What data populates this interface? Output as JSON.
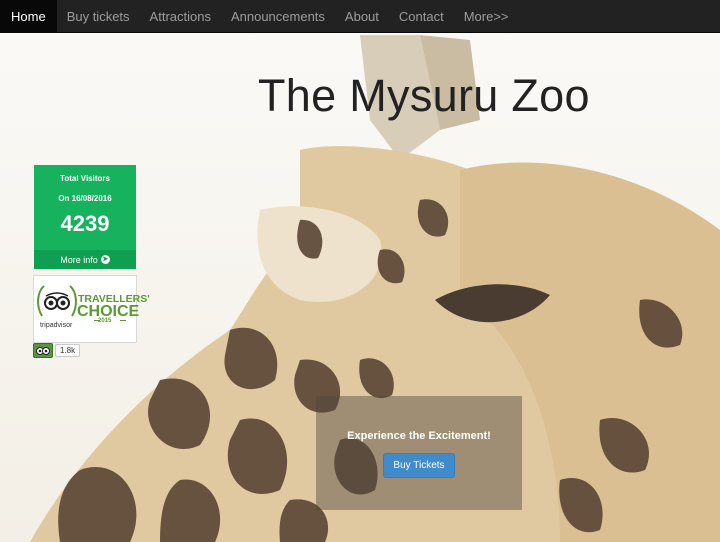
{
  "nav": {
    "items": [
      {
        "label": "Home",
        "active": true
      },
      {
        "label": "Buy tickets"
      },
      {
        "label": "Attractions"
      },
      {
        "label": "Announcements"
      },
      {
        "label": "About"
      },
      {
        "label": "Contact"
      },
      {
        "label": "More>>"
      }
    ]
  },
  "page_title": "The Mysuru Zoo",
  "visitors": {
    "label": "Total Visitors",
    "date": "On 16/08/2016",
    "count": "4239",
    "more_label": "More info",
    "accent": "#17b25d"
  },
  "tripadvisor": {
    "line1": "TRAVELLERS'",
    "line2": "CHOICE",
    "year": "2015",
    "brand": "tripadvisor",
    "follow_count": "1.8k",
    "color": "#5b9a30"
  },
  "cta": {
    "text": "Experience the Excitement!",
    "button_label": "Buy Tickets"
  }
}
